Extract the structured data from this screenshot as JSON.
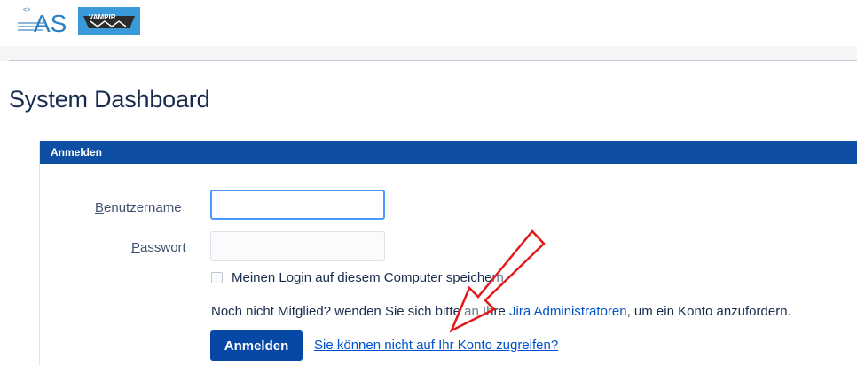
{
  "logos": {
    "as_logo_text": "AS",
    "vampir_logo_text": "VAMPIR"
  },
  "page": {
    "title": "System Dashboard"
  },
  "login_panel": {
    "header": "Anmelden",
    "username_label_first": "B",
    "username_label_rest": "enutzername",
    "username_value": "",
    "password_label_first": "P",
    "password_label_rest": "asswort",
    "password_value": "",
    "remember_first": "M",
    "remember_rest": "einen Login auf diesem Computer speichern",
    "signup_prefix": "Noch nicht Mitglied? wenden Sie sich bitte an Ihre ",
    "signup_link": "Jira Administratoren",
    "signup_suffix": ", um ein Konto anzufordern.",
    "submit_label": "Anmelden",
    "forgot_link": "Sie können nicht auf Ihr Konto zugreifen?"
  },
  "colors": {
    "panel_header": "#0e4ea3",
    "button": "#0747a6",
    "link": "#0052cc",
    "annotation_arrow": "#e3191c"
  },
  "annotation": {
    "icon": "red-outline-arrow-icon"
  }
}
